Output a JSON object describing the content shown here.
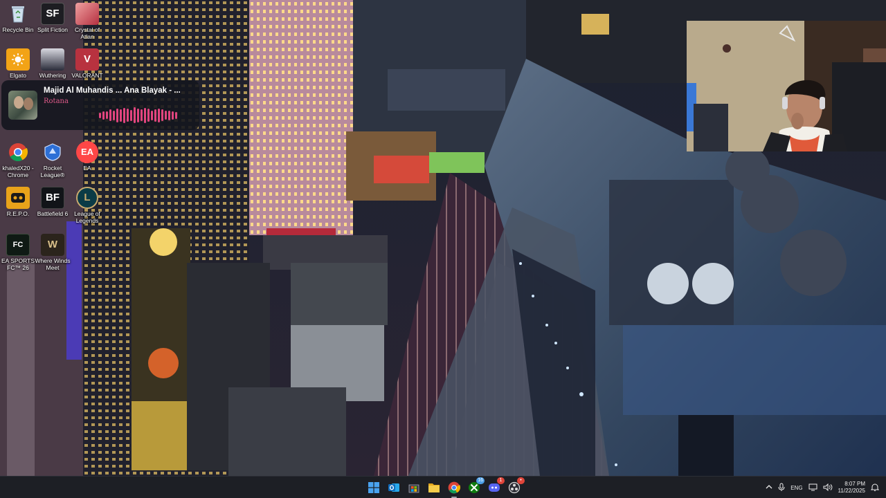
{
  "desktop_icons": [
    {
      "id": "recycle-bin",
      "label": "Recycle Bin",
      "icon": "recycle-bin-icon",
      "color": "#9fb4c8"
    },
    {
      "id": "split-fiction",
      "label": "Split Fiction",
      "icon": "split-fiction-icon",
      "glyph": "SF",
      "color": "#1d1d22"
    },
    {
      "id": "crystal-of-atlan",
      "label": "Crystal of Atlan",
      "icon": "crystal-of-atlan-icon",
      "color": "#c9484a"
    },
    {
      "id": "elgato",
      "label": "Elgato",
      "icon": "elgato-sun-icon",
      "color": "#f2a316"
    },
    {
      "id": "wuthering",
      "label": "Wuthering",
      "icon": "wuthering-waves-icon",
      "color": "#2a2c3a"
    },
    {
      "id": "valorant",
      "label": "VALORANT",
      "icon": "valorant-icon",
      "glyph": "V",
      "color": "#b8323f"
    },
    {
      "id": "chrome",
      "label": "khaledX20 - Chrome",
      "icon": "chrome-icon",
      "color": "#4285f4"
    },
    {
      "id": "rocket-league",
      "label": "Rocket League®",
      "icon": "rocket-league-icon",
      "color": "#2d6fd6"
    },
    {
      "id": "ea",
      "label": "EA",
      "icon": "ea-icon",
      "glyph": "EA",
      "color": "#ff4747"
    },
    {
      "id": "repo",
      "label": "R.E.P.O.",
      "icon": "repo-robot-icon",
      "color": "#e8a31a"
    },
    {
      "id": "battlefield-6",
      "label": "Battlefield 6",
      "icon": "battlefield-icon",
      "glyph": "BF",
      "color": "#111418"
    },
    {
      "id": "league-of-legends",
      "label": "League of Legends",
      "icon": "league-of-legends-icon",
      "glyph": "L",
      "color": "#0b3b46"
    },
    {
      "id": "ea-fc-26",
      "label": "EA SPORTS FC™ 26",
      "icon": "ea-sports-fc-icon",
      "glyph": "FC",
      "color": "#0f1a14"
    },
    {
      "id": "where-winds-meet",
      "label": "Where Winds Meet",
      "icon": "where-winds-meet-icon",
      "glyph": "W",
      "color": "#2b241c"
    }
  ],
  "now_playing": {
    "title": "Majid Al Muhandis ... Ana Blayak - ...",
    "artist": "Rotana",
    "accent": "#e2457f",
    "bar_levels": [
      0.35,
      0.5,
      0.45,
      0.7,
      0.6,
      0.85,
      0.75,
      0.9,
      0.8,
      0.65,
      0.95,
      0.85,
      0.7,
      0.9,
      0.8,
      0.6,
      0.75,
      0.85,
      0.7,
      0.55,
      0.6,
      0.5,
      0.4
    ]
  },
  "webcam": {
    "description_icon": "webcam-feed"
  },
  "taskbar": {
    "apps": [
      {
        "id": "start",
        "icon": "windows-start-icon",
        "color": "#4aa3f0"
      },
      {
        "id": "outlook",
        "icon": "outlook-icon",
        "color": "#0f6cbd"
      },
      {
        "id": "store",
        "icon": "microsoft-store-icon",
        "color": "#3b3f48"
      },
      {
        "id": "file-explorer",
        "icon": "file-explorer-icon",
        "color": "#f0c23a"
      },
      {
        "id": "chrome",
        "icon": "chrome-icon",
        "color": "#4285f4",
        "active": true
      },
      {
        "id": "xbox",
        "icon": "xbox-icon",
        "color": "#107c10",
        "badge": "16"
      },
      {
        "id": "discord",
        "icon": "discord-icon",
        "color": "#5865f2",
        "badge": "1"
      },
      {
        "id": "obs",
        "icon": "obs-icon",
        "color": "#2e2e36",
        "badge": "•"
      }
    ],
    "tray": {
      "language": "ENG",
      "time": "8:07 PM",
      "date": "11/22/2025"
    }
  }
}
